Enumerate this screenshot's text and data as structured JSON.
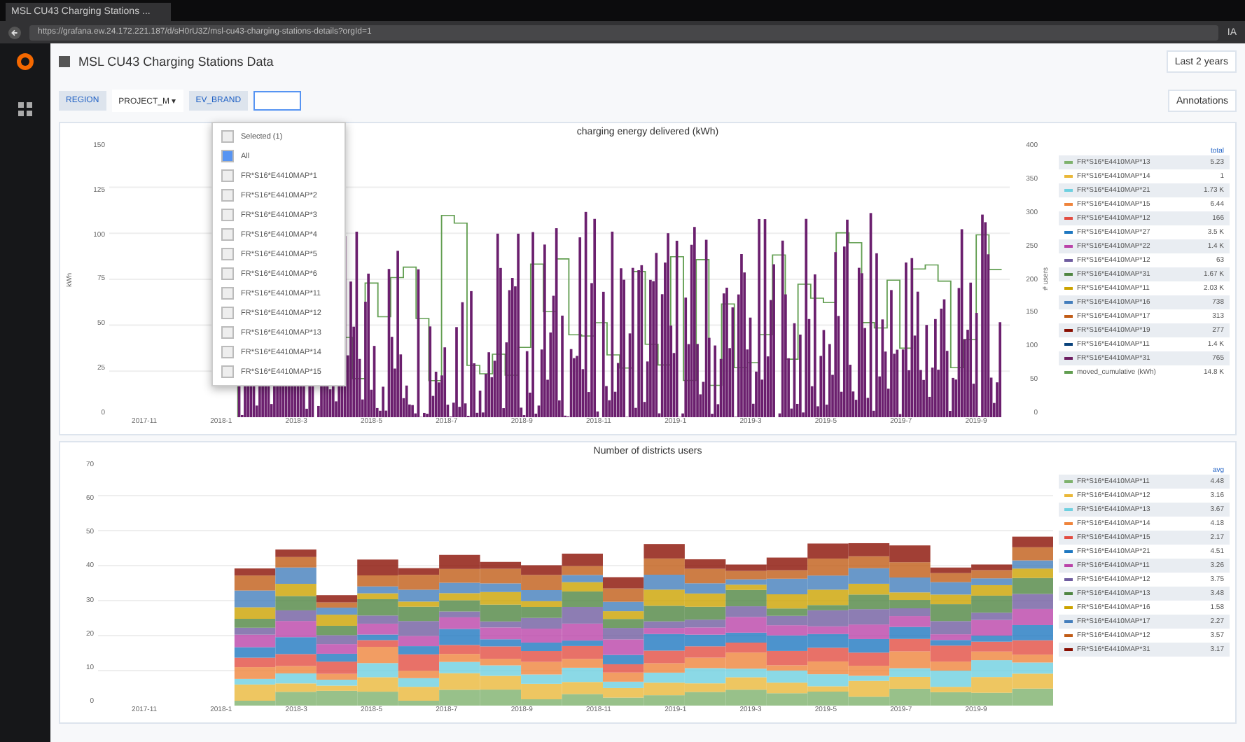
{
  "browser": {
    "tab_title": "MSL CU43 Charging Stations ...",
    "url": "https://grafana.ew.24.172.221.187/d/sH0rU3Z/msl-cu43-charging-stations-details?orgId=1",
    "zoom": "IA"
  },
  "dashboard": {
    "title": "MSL CU43 Charging Stations Data",
    "time_range": "Last 2 years",
    "annotations": "Annotations"
  },
  "variables": [
    {
      "label": "REGION",
      "value": "PROJECT_M ▾"
    },
    {
      "label": "EV_BRAND"
    }
  ],
  "dropdown": {
    "items": [
      {
        "label": "Selected (1)",
        "checked": false
      },
      {
        "label": "All",
        "checked": true
      },
      {
        "label": "FR*S16*E4410MAP*1",
        "checked": false
      },
      {
        "label": "FR*S16*E4410MAP*2",
        "checked": false
      },
      {
        "label": "FR*S16*E4410MAP*3",
        "checked": false
      },
      {
        "label": "FR*S16*E4410MAP*4",
        "checked": false
      },
      {
        "label": "FR*S16*E4410MAP*5",
        "checked": false
      },
      {
        "label": "FR*S16*E4410MAP*6",
        "checked": false
      },
      {
        "label": "FR*S16*E4410MAP*11",
        "checked": false
      },
      {
        "label": "FR*S16*E4410MAP*12",
        "checked": false
      },
      {
        "label": "FR*S16*E4410MAP*13",
        "checked": false
      },
      {
        "label": "FR*S16*E4410MAP*14",
        "checked": false
      },
      {
        "label": "FR*S16*E4410MAP*15",
        "checked": false
      }
    ]
  },
  "panels": [
    {
      "title": "charging energy delivered (kWh)",
      "kind": "bars",
      "y_label": "kWh",
      "y2_label": "# users",
      "y_ticks": [
        "150",
        "125",
        "100",
        "75",
        "50",
        "25",
        "0"
      ],
      "y2_ticks": [
        "400",
        "350",
        "300",
        "250",
        "200",
        "150",
        "100",
        "50",
        "0"
      ],
      "x_ticks": [
        "2017-11",
        "2018-1",
        "2018-3",
        "2018-5",
        "2018-7",
        "2018-9",
        "2018-11",
        "2019-1",
        "2019-3",
        "2019-5",
        "2019-7",
        "2019-9"
      ],
      "legend_header": "total",
      "legend": [
        {
          "name": "FR*S16*E4410MAP*13",
          "value": "5.23",
          "color": "#7eb26d"
        },
        {
          "name": "FR*S16*E4410MAP*14",
          "value": "1",
          "color": "#eab839"
        },
        {
          "name": "FR*S16*E4410MAP*21",
          "value": "1.73 K",
          "color": "#6ed0e0"
        },
        {
          "name": "FR*S16*E4410MAP*15",
          "value": "6.44",
          "color": "#ef843c"
        },
        {
          "name": "FR*S16*E4410MAP*12",
          "value": "166",
          "color": "#e24d42"
        },
        {
          "name": "FR*S16*E4410MAP*27",
          "value": "3.5 K",
          "color": "#1f78c1"
        },
        {
          "name": "FR*S16*E4410MAP*22",
          "value": "1.4 K",
          "color": "#ba43a9"
        },
        {
          "name": "FR*S16*E4410MAP*12",
          "value": "63",
          "color": "#705da0"
        },
        {
          "name": "FR*S16*E4410MAP*31",
          "value": "1.67 K",
          "color": "#508642"
        },
        {
          "name": "FR*S16*E4410MAP*11",
          "value": "2.03 K",
          "color": "#cca300"
        },
        {
          "name": "FR*S16*E4410MAP*16",
          "value": "738",
          "color": "#447ebc"
        },
        {
          "name": "FR*S16*E4410MAP*17",
          "value": "313",
          "color": "#c15c17"
        },
        {
          "name": "FR*S16*E4410MAP*19",
          "value": "277",
          "color": "#890f02"
        },
        {
          "name": "FR*S16*E4410MAP*11",
          "value": "1.4 K",
          "color": "#0a437c"
        },
        {
          "name": "FR*S16*E4410MAP*31",
          "value": "765",
          "color": "#6d1f62"
        },
        {
          "name": "moved_cumulative (kWh)",
          "value": "14.8 K",
          "color": "#629e51"
        }
      ]
    },
    {
      "title": "Number of districts users",
      "kind": "stacked",
      "y_ticks": [
        "70",
        "60",
        "50",
        "40",
        "30",
        "20",
        "10",
        "0"
      ],
      "x_ticks": [
        "2017-11",
        "2018-1",
        "2018-3",
        "2018-5",
        "2018-7",
        "2018-9",
        "2018-11",
        "2019-1",
        "2019-3",
        "2019-5",
        "2019-7",
        "2019-9"
      ],
      "legend_header": "avg",
      "legend": [
        {
          "name": "FR*S16*E4410MAP*11",
          "value": "4.48",
          "color": "#7eb26d"
        },
        {
          "name": "FR*S16*E4410MAP*12",
          "value": "3.16",
          "color": "#eab839"
        },
        {
          "name": "FR*S16*E4410MAP*13",
          "value": "3.67",
          "color": "#6ed0e0"
        },
        {
          "name": "FR*S16*E4410MAP*14",
          "value": "4.18",
          "color": "#ef843c"
        },
        {
          "name": "FR*S16*E4410MAP*15",
          "value": "2.17",
          "color": "#e24d42"
        },
        {
          "name": "FR*S16*E4410MAP*21",
          "value": "4.51",
          "color": "#1f78c1"
        },
        {
          "name": "FR*S16*E4410MAP*11",
          "value": "3.26",
          "color": "#ba43a9"
        },
        {
          "name": "FR*S16*E4410MAP*12",
          "value": "3.75",
          "color": "#705da0"
        },
        {
          "name": "FR*S16*E4410MAP*13",
          "value": "3.48",
          "color": "#508642"
        },
        {
          "name": "FR*S16*E4410MAP*16",
          "value": "1.58",
          "color": "#cca300"
        },
        {
          "name": "FR*S16*E4410MAP*17",
          "value": "2.27",
          "color": "#447ebc"
        },
        {
          "name": "FR*S16*E4410MAP*12",
          "value": "3.57",
          "color": "#c15c17"
        },
        {
          "name": "FR*S16*E4410MAP*31",
          "value": "3.17",
          "color": "#890f02"
        }
      ]
    }
  ]
}
